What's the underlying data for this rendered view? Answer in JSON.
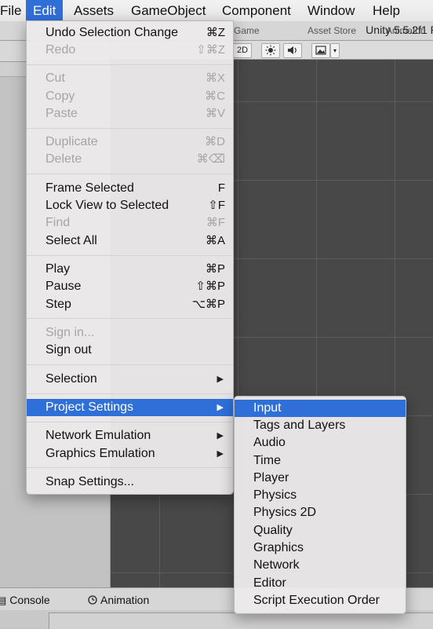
{
  "menubar": {
    "items": [
      {
        "label": "File"
      },
      {
        "label": "Edit"
      },
      {
        "label": "Assets"
      },
      {
        "label": "GameObject"
      },
      {
        "label": "Component"
      },
      {
        "label": "Window"
      },
      {
        "label": "Help"
      }
    ]
  },
  "window": {
    "title": "Unity 5.5.2f1 P",
    "background_tabs": [
      "Game",
      "Asset Store",
      "Animator"
    ]
  },
  "scene_toolbar": {
    "mode_2d": "2D",
    "light_icon": "sun-icon",
    "audio_icon": "speaker-icon",
    "effects_icon": "image-icon",
    "dropdown_icon": "chevron-down-icon"
  },
  "edit_menu": {
    "undo": {
      "label": "Undo Selection Change",
      "shortcut": "⌘Z"
    },
    "redo": {
      "label": "Redo",
      "shortcut": "⇧⌘Z"
    },
    "cut": {
      "label": "Cut",
      "shortcut": "⌘X"
    },
    "copy": {
      "label": "Copy",
      "shortcut": "⌘C"
    },
    "paste": {
      "label": "Paste",
      "shortcut": "⌘V"
    },
    "duplicate": {
      "label": "Duplicate",
      "shortcut": "⌘D"
    },
    "delete": {
      "label": "Delete",
      "shortcut": "⌘⌫"
    },
    "frame_selected": {
      "label": "Frame Selected",
      "shortcut": "F"
    },
    "lock_view": {
      "label": "Lock View to Selected",
      "shortcut": "⇧F"
    },
    "find": {
      "label": "Find",
      "shortcut": "⌘F"
    },
    "select_all": {
      "label": "Select All",
      "shortcut": "⌘A"
    },
    "play": {
      "label": "Play",
      "shortcut": "⌘P"
    },
    "pause": {
      "label": "Pause",
      "shortcut": "⇧⌘P"
    },
    "step": {
      "label": "Step",
      "shortcut": "⌥⌘P"
    },
    "sign_in": {
      "label": "Sign in..."
    },
    "sign_out": {
      "label": "Sign out"
    },
    "selection": {
      "label": "Selection"
    },
    "project_settings": {
      "label": "Project Settings"
    },
    "network_emulation": {
      "label": "Network Emulation"
    },
    "graphics_emulation": {
      "label": "Graphics Emulation"
    },
    "snap_settings": {
      "label": "Snap Settings..."
    },
    "submenu_arrow": "▶"
  },
  "project_settings_submenu": {
    "items": [
      {
        "label": "Input"
      },
      {
        "label": "Tags and Layers"
      },
      {
        "label": "Audio"
      },
      {
        "label": "Time"
      },
      {
        "label": "Player"
      },
      {
        "label": "Physics"
      },
      {
        "label": "Physics 2D"
      },
      {
        "label": "Quality"
      },
      {
        "label": "Graphics"
      },
      {
        "label": "Network"
      },
      {
        "label": "Editor"
      },
      {
        "label": "Script Execution Order"
      }
    ]
  },
  "bottom_tabs": {
    "console": {
      "label": "Console",
      "icon": "console-icon"
    },
    "animation": {
      "label": "Animation",
      "icon": "clock-icon"
    }
  },
  "colors": {
    "highlight": "#2f6fd8",
    "scene_bg": "#484848",
    "menu_bg": "#ebe9e9"
  }
}
